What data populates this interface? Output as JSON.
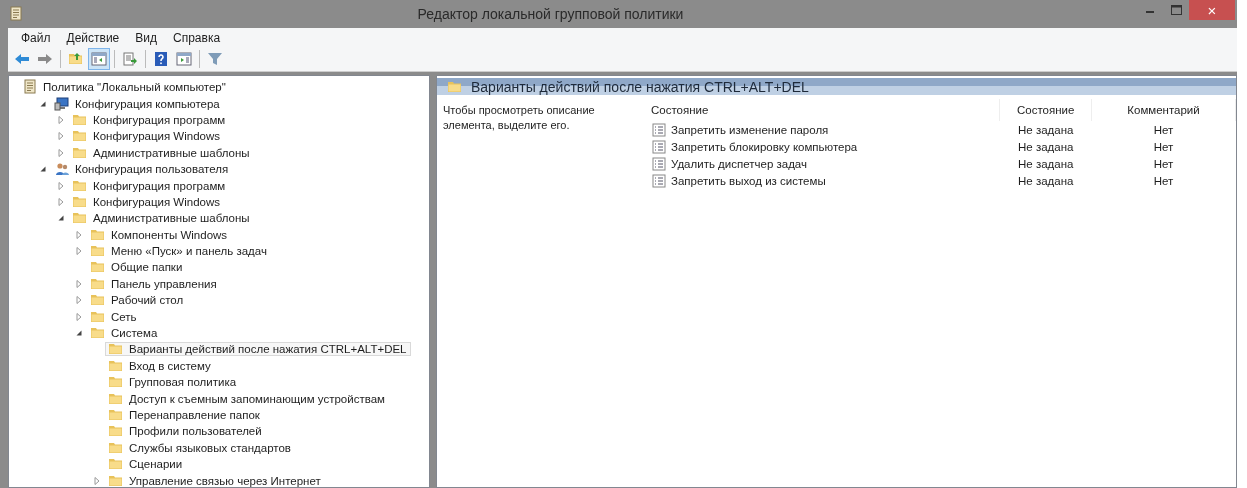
{
  "window": {
    "title": "Редактор локальной групповой политики",
    "close": "×"
  },
  "menu": [
    "Файл",
    "Действие",
    "Вид",
    "Справка"
  ],
  "toolbar": [
    {
      "kind": "back",
      "pressed": false
    },
    {
      "kind": "forward",
      "pressed": false
    },
    {
      "kind": "sep"
    },
    {
      "kind": "up",
      "pressed": false
    },
    {
      "kind": "tree",
      "pressed": true
    },
    {
      "kind": "sep"
    },
    {
      "kind": "export",
      "pressed": false
    },
    {
      "kind": "sep"
    },
    {
      "kind": "help",
      "pressed": false
    },
    {
      "kind": "pane",
      "pressed": false
    },
    {
      "kind": "sep"
    },
    {
      "kind": "filter",
      "pressed": false
    }
  ],
  "tree": [
    {
      "label": "Политика \"Локальный компьютер\"",
      "kind": "root",
      "selected": false,
      "children": [
        {
          "label": "Конфигурация компьютера",
          "kind": "computer",
          "expanded": true,
          "selected": false,
          "children": [
            {
              "label": "Конфигурация программ",
              "kind": "folder",
              "expanded": false,
              "selected": false
            },
            {
              "label": "Конфигурация Windows",
              "kind": "folder",
              "expanded": false,
              "selected": false
            },
            {
              "label": "Административные шаблоны",
              "kind": "folder",
              "expanded": false,
              "selected": false
            }
          ]
        },
        {
          "label": "Конфигурация пользователя",
          "kind": "user",
          "expanded": true,
          "selected": false,
          "children": [
            {
              "label": "Конфигурация программ",
              "kind": "folder",
              "expanded": false,
              "selected": false
            },
            {
              "label": "Конфигурация Windows",
              "kind": "folder",
              "expanded": false,
              "selected": false
            },
            {
              "label": "Административные шаблоны",
              "kind": "folder",
              "expanded": true,
              "selected": false,
              "children": [
                {
                  "label": "Компоненты Windows",
                  "kind": "folder",
                  "expanded": false,
                  "selected": false
                },
                {
                  "label": "Меню «Пуск» и панель задач",
                  "kind": "folder",
                  "expanded": false,
                  "selected": false
                },
                {
                  "label": "Общие папки",
                  "kind": "folder",
                  "selected": false
                },
                {
                  "label": "Панель управления",
                  "kind": "folder",
                  "expanded": false,
                  "selected": false
                },
                {
                  "label": "Рабочий стол",
                  "kind": "folder",
                  "expanded": false,
                  "selected": false
                },
                {
                  "label": "Сеть",
                  "kind": "folder",
                  "expanded": false,
                  "selected": false
                },
                {
                  "label": "Система",
                  "kind": "folder",
                  "expanded": true,
                  "selected": false,
                  "children": [
                    {
                      "label": "Варианты действий после нажатия CTRL+ALT+DEL",
                      "kind": "folder",
                      "selected": true
                    },
                    {
                      "label": "Вход в систему",
                      "kind": "folder",
                      "selected": false
                    },
                    {
                      "label": "Групповая политика",
                      "kind": "folder",
                      "selected": false
                    },
                    {
                      "label": "Доступ к съемным запоминающим устройствам",
                      "kind": "folder",
                      "selected": false
                    },
                    {
                      "label": "Перенаправление папок",
                      "kind": "folder",
                      "selected": false
                    },
                    {
                      "label": "Профили пользователей",
                      "kind": "folder",
                      "selected": false
                    },
                    {
                      "label": "Службы языковых стандартов",
                      "kind": "folder",
                      "selected": false
                    },
                    {
                      "label": "Сценарии",
                      "kind": "folder",
                      "selected": false
                    },
                    {
                      "label": "Управление связью через Интернет",
                      "kind": "folder",
                      "expanded": false,
                      "selected": false
                    }
                  ]
                }
              ]
            }
          ]
        }
      ]
    }
  ],
  "details": {
    "title": "Варианты действий после нажатия CTRL+ALT+DEL",
    "description": "Чтобы просмотреть описание элемента, выделите его.",
    "columns": [
      "Состояние",
      "Состояние",
      "Комментарий"
    ],
    "rows": [
      {
        "name": "Запретить изменение пароля",
        "state": "Не задана",
        "comment": "Нет"
      },
      {
        "name": "Запретить блокировку компьютера",
        "state": "Не задана",
        "comment": "Нет"
      },
      {
        "name": "Удалить диспетчер задач",
        "state": "Не задана",
        "comment": "Нет"
      },
      {
        "name": "Запретить выход из системы",
        "state": "Не задана",
        "comment": "Нет"
      }
    ]
  }
}
